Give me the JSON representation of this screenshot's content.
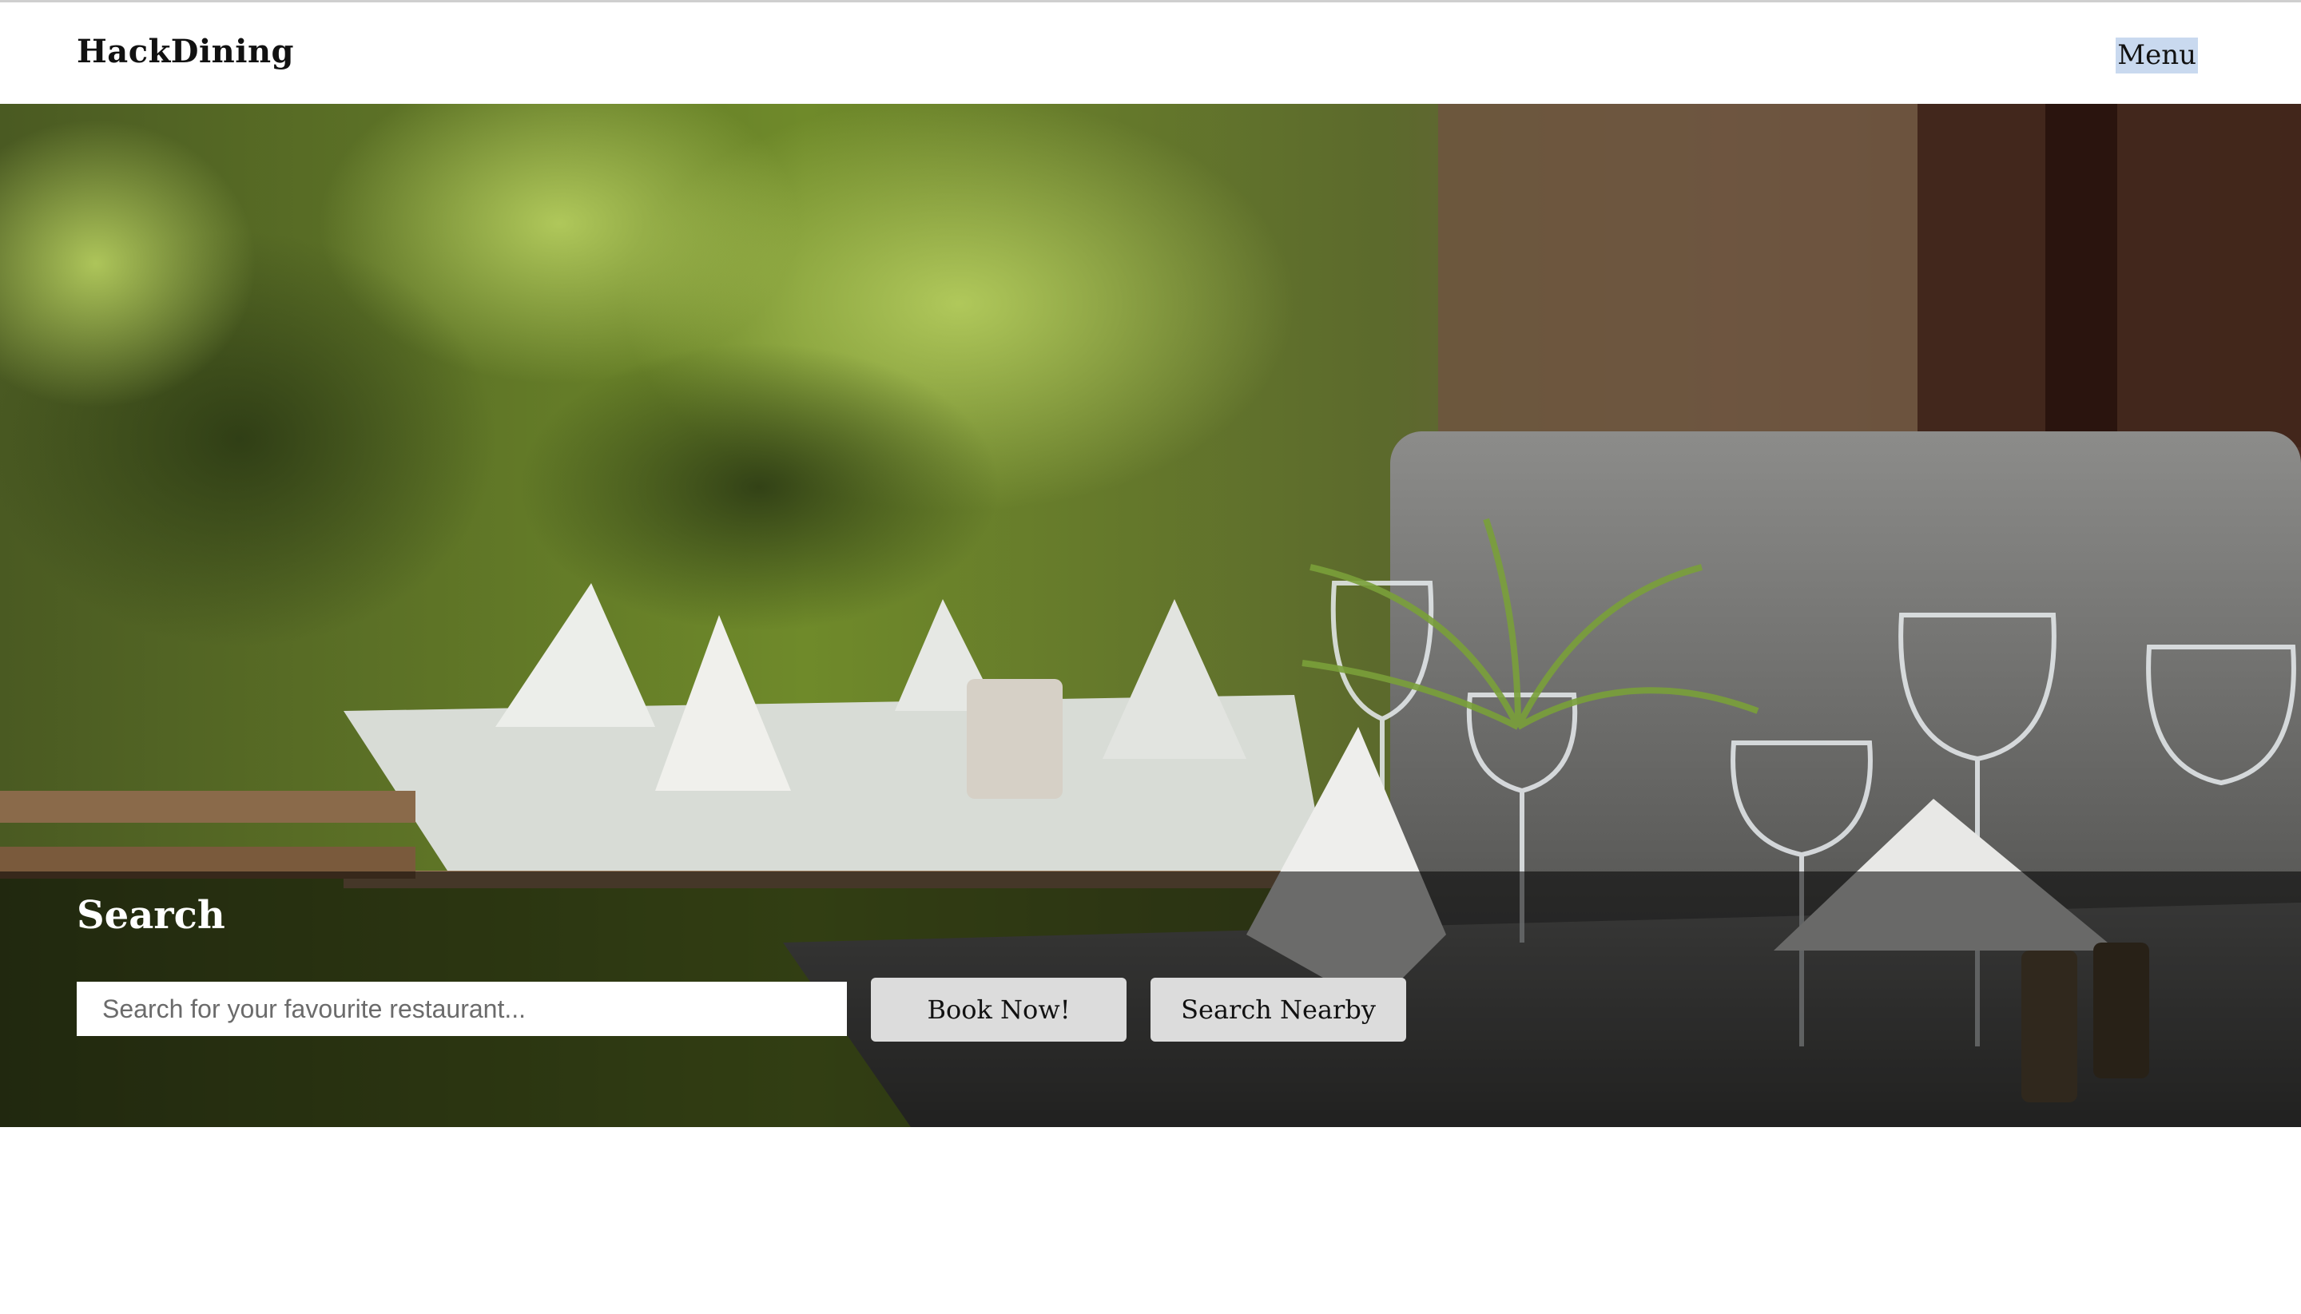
{
  "header": {
    "brand": "HackDining",
    "menu_label": "Menu"
  },
  "hero": {
    "image_subject": "outdoor-restaurant-table-setting"
  },
  "search": {
    "title": "Search",
    "placeholder": "Search for your favourite restaurant...",
    "value": "",
    "book_label": "Book Now!",
    "nearby_label": "Search Nearby"
  },
  "colors": {
    "overlay": "#000000",
    "button_bg": "#dcdcdc",
    "menu_highlight": "#c9d9ef"
  }
}
